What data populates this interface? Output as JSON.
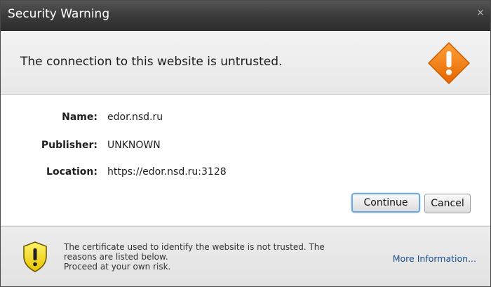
{
  "window": {
    "title": "Security Warning",
    "close_glyph": "×"
  },
  "header": {
    "headline": "The connection to this website is untrusted.",
    "icon": "warning-diamond-icon",
    "icon_color": "#f07a12"
  },
  "details": [
    {
      "label": "Name:",
      "value": "edor.nsd.ru"
    },
    {
      "label": "Publisher:",
      "value": "UNKNOWN"
    },
    {
      "label": "Location:",
      "value": "https://edor.nsd.ru:3128"
    }
  ],
  "buttons": {
    "continue_label": "Continue",
    "cancel_label": "Cancel"
  },
  "footer": {
    "icon": "shield-warning-icon",
    "line1": "The certificate used to identify the website is not trusted.  The",
    "line2": "reasons are listed below.",
    "line3": "Proceed at your own risk.",
    "more_info_label": "More Information..."
  }
}
